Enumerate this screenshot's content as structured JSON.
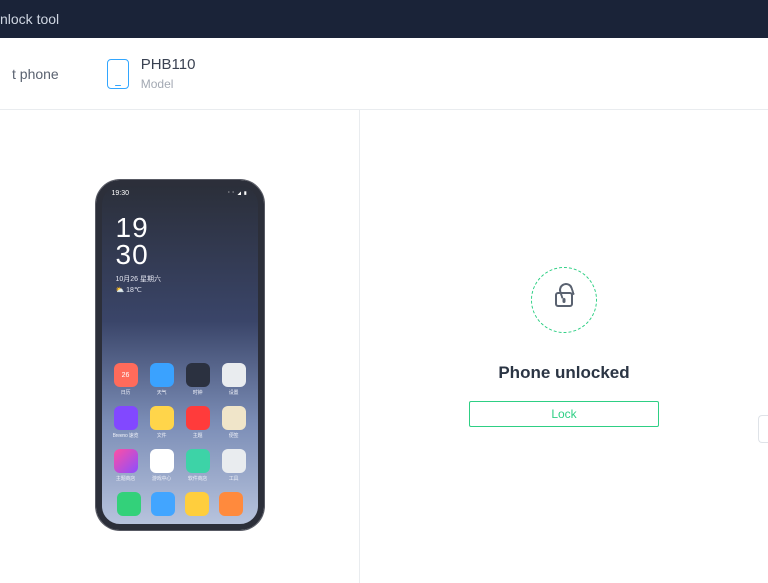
{
  "window": {
    "title": "nlock tool"
  },
  "device": {
    "connect_label": "t phone",
    "model": "PHB110",
    "model_sub": "Model"
  },
  "phone": {
    "status_time": "19:30",
    "clock_line1": "19",
    "clock_line2": "30",
    "date": "10月26 星期六",
    "temp": "⛅ 18℃",
    "apps_row1": [
      {
        "label": "日历",
        "color": "#ff6b5b"
      },
      {
        "label": "天气",
        "color": "#3aa2ff"
      },
      {
        "label": "时钟",
        "color": "#2b3140"
      },
      {
        "label": "设置",
        "color": "#e9ecef"
      }
    ],
    "apps_row2": [
      {
        "label": "Breeno 速览",
        "color": "#8248ff"
      },
      {
        "label": "文件",
        "color": "#ffd54a"
      },
      {
        "label": "主题",
        "color": "#ff3b3b"
      },
      {
        "label": "便签",
        "color": "#f0e5c9"
      }
    ],
    "apps_row3": [
      {
        "label": "主题商店",
        "color": "#ff4fa3"
      },
      {
        "label": "游戏中心",
        "color": "#ffffff"
      },
      {
        "label": "软件商店",
        "color": "#3dd3a7"
      },
      {
        "label": "工具",
        "color": "#e9ecef"
      }
    ],
    "dock": [
      {
        "color": "#33d17a"
      },
      {
        "color": "#42a5ff"
      },
      {
        "color": "#ffce3d"
      },
      {
        "color": "#ff8a3d"
      }
    ]
  },
  "status": {
    "headline": "Phone unlocked",
    "button": "Lock"
  }
}
